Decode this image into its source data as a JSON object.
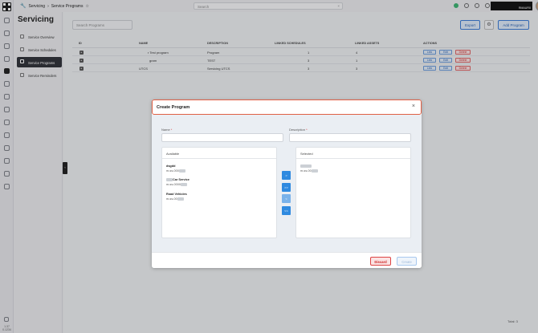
{
  "topbar": {
    "breadcrumb": [
      "Servicing",
      "Service Programs"
    ],
    "search_placeholder": "Search",
    "username": "RMAUR0"
  },
  "sidebar": {
    "title": "Servicing",
    "items": [
      {
        "label": "Service Overview",
        "icon": "chart-icon",
        "active": false
      },
      {
        "label": "Service Schedules",
        "icon": "calendar-icon",
        "active": false
      },
      {
        "label": "Service Programs",
        "icon": "clipboard-icon",
        "active": true
      },
      {
        "label": "Service Reminders",
        "icon": "bell-icon",
        "active": false
      }
    ]
  },
  "rail": {
    "version": [
      "1.37",
      "0.1234"
    ]
  },
  "main": {
    "search_placeholder": "Search Programs",
    "export_label": "Export",
    "add_label": "Add Program",
    "columns": [
      "ID",
      "NAME",
      "DESCRIPTION",
      "LINKED SCHEDULES",
      "LINKED ASSETS",
      "ACTIONS"
    ],
    "rows": [
      {
        "id": "",
        "name": "r Test program",
        "description": "Program",
        "schedules": "1",
        "assets": "4"
      },
      {
        "id": "",
        "name": "gram",
        "description": "TEST",
        "schedules": "3",
        "assets": "1"
      },
      {
        "id": "",
        "name": "UTCS",
        "description": "Servicing UTCS",
        "schedules": "3",
        "assets": "3"
      }
    ],
    "actions": {
      "link": "Link",
      "edit": "Edit",
      "delete": "Delete"
    },
    "total": "Total: 3"
  },
  "modal": {
    "title": "Create Program",
    "name_label": "Name",
    "description_label": "Description",
    "required_mark": "*",
    "available_label": "Available",
    "selected_label": "Selected",
    "available": [
      {
        "name": "dsgdd",
        "code": "m-ss-000"
      },
      {
        "name": "Car Service",
        "code": "m-ss-0000"
      },
      {
        "name": "Road Vehicles",
        "code": "m-ss-00"
      }
    ],
    "selected": [
      {
        "name": "",
        "code": "m-ss-00"
      }
    ],
    "move_buttons": [
      ">",
      ">>",
      "<",
      "<<"
    ],
    "discard_label": "Discard",
    "create_label": "Create"
  },
  "colors": {
    "accent": "#2f8ae0",
    "danger": "#cc3333",
    "modal_header_border": "#e06045",
    "sidebar_active": "#2f3137"
  }
}
